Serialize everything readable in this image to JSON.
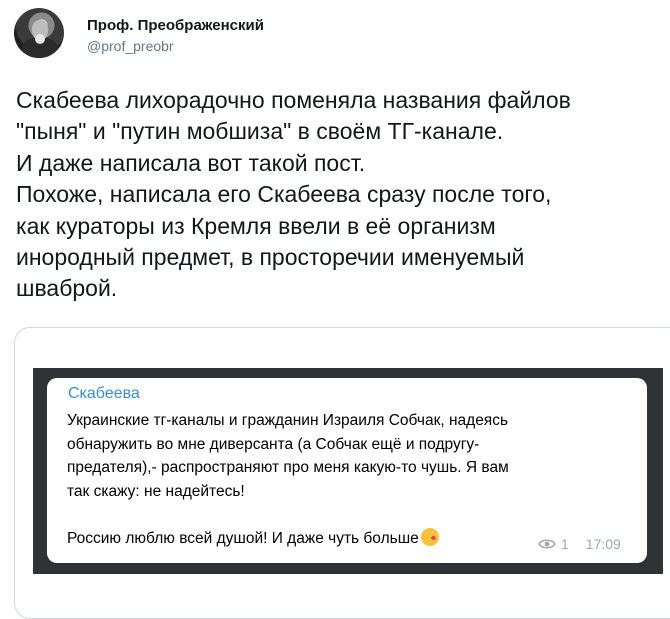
{
  "author": {
    "name": "Проф. Преображенский",
    "handle": "@prof_preobr"
  },
  "tweet": {
    "lines": [
      "Скабеева лихорадочно поменяла названия файлов",
      "\"пыня\" и \"путин мобшиза\" в своём ТГ-канале.",
      "И даже написала вот такой пост.",
      "Похоже, написала его Скабеева сразу после того,",
      "как кураторы из Кремля ввели в её организм",
      "инородный предмет, в просторечии именуемый",
      "шваброй."
    ]
  },
  "telegram_post": {
    "channel": "Скабеева",
    "lines": [
      "Украинские тг-каналы и гражданин Израиля Собчак, надеясь",
      "обнаружить во мне диверсанта (а Собчак ещё и подругу-",
      "предателя),- распространяют про меня какую-то чушь. Я вам",
      "так скажу: не надейтесь!"
    ],
    "last_line": "Россию люблю всей душой! И даже чуть больше",
    "emoji": "kissing-face-emoji",
    "views": "1",
    "time": "17:09"
  },
  "colors": {
    "link_blue": "#3a8fd1",
    "window_dark": "#303335",
    "meta_gray": "#a0a7ad"
  }
}
